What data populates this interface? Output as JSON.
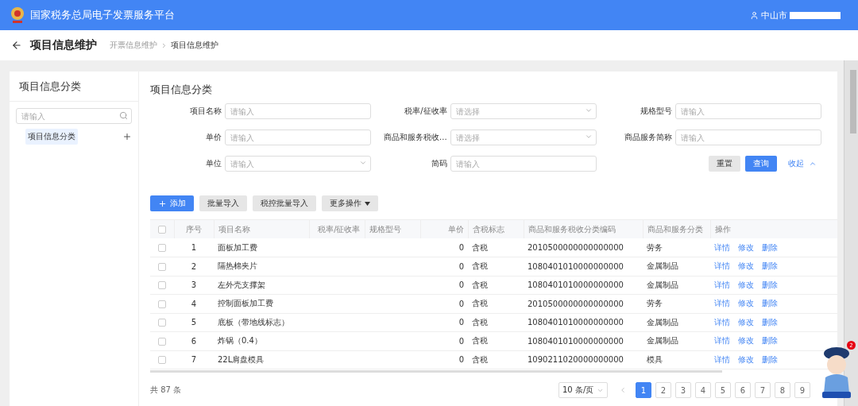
{
  "header": {
    "title": "国家税务总局电子发票服务平台",
    "user": "中山市"
  },
  "page": {
    "title": "项目信息维护",
    "breadcrumb": [
      {
        "label": "开票信息维护",
        "current": false
      },
      {
        "label": "项目信息维护",
        "current": true
      }
    ]
  },
  "sidebar": {
    "title": "项目信息分类",
    "search": {
      "placeholder": "请输入"
    },
    "items": [
      {
        "label": "项目信息分类",
        "selected": true
      }
    ]
  },
  "filter": {
    "title": "项目信息分类",
    "fields": [
      {
        "label": "项目名称",
        "kind": "input",
        "placeholder": "请输入"
      },
      {
        "label": "税率/征收率",
        "kind": "select",
        "placeholder": "请选择"
      },
      {
        "label": "规格型号",
        "kind": "input",
        "placeholder": "请输入"
      },
      {
        "label": "单价",
        "kind": "input",
        "placeholder": "请输入"
      },
      {
        "label": "商品和服务税收...",
        "kind": "select",
        "placeholder": "请选择"
      },
      {
        "label": "商品服务简称",
        "kind": "input",
        "placeholder": "请输入"
      },
      {
        "label": "单位",
        "kind": "select",
        "placeholder": "请输入"
      },
      {
        "label": "简码",
        "kind": "input",
        "placeholder": "请输入"
      }
    ],
    "reset": "重置",
    "query": "查询",
    "collapse": "收起"
  },
  "toolbar": [
    {
      "label": "添加",
      "kind": "primary"
    },
    {
      "label": "批量导入",
      "kind": "plain"
    },
    {
      "label": "税控批量导入",
      "kind": "plain"
    },
    {
      "label": "更多操作",
      "kind": "dropdown"
    }
  ],
  "table": {
    "select_all_checked": false,
    "columns": [
      "序号",
      "项目名称",
      "税率/征收率",
      "规格型号",
      "单价",
      "含税标志",
      "商品和服务税收分类编码",
      "商品和服务分类",
      "操作"
    ],
    "rows": [
      {
        "checked": false,
        "cells": [
          "1",
          "面板加工费",
          "",
          "",
          "0",
          "含税",
          "2010500000000000000",
          "劳务"
        ],
        "actions": [
          "详情",
          "修改",
          "删除"
        ]
      },
      {
        "checked": false,
        "cells": [
          "2",
          "隔热棉夹片",
          "",
          "",
          "0",
          "含税",
          "1080401010000000000",
          "金属制品"
        ],
        "actions": [
          "详情",
          "修改",
          "删除"
        ]
      },
      {
        "checked": false,
        "cells": [
          "3",
          "左外壳支撑架",
          "",
          "",
          "0",
          "含税",
          "1080401010000000000",
          "金属制品"
        ],
        "actions": [
          "详情",
          "修改",
          "删除"
        ]
      },
      {
        "checked": false,
        "cells": [
          "4",
          "控制面板加工费",
          "",
          "",
          "0",
          "含税",
          "2010500000000000000",
          "劳务"
        ],
        "actions": [
          "详情",
          "修改",
          "删除"
        ]
      },
      {
        "checked": false,
        "cells": [
          "5",
          "底板（带地线标志）",
          "",
          "",
          "0",
          "含税",
          "1080401010000000000",
          "金属制品"
        ],
        "actions": [
          "详情",
          "修改",
          "删除"
        ]
      },
      {
        "checked": false,
        "cells": [
          "6",
          "炸锅（0.4）",
          "",
          "",
          "0",
          "含税",
          "1080401010000000000",
          "金属制品"
        ],
        "actions": [
          "详情",
          "修改",
          "删除"
        ]
      },
      {
        "checked": false,
        "cells": [
          "7",
          "22L肩盘模具",
          "",
          "",
          "0",
          "含税",
          "1090211020000000000",
          "模具"
        ],
        "actions": [
          "详情",
          "修改",
          "删除"
        ]
      }
    ]
  },
  "pagination": {
    "total": "共 87 条",
    "page_size": "10 条/页",
    "pages": [
      {
        "label": "1",
        "selected": true
      },
      {
        "label": "2",
        "selected": false
      },
      {
        "label": "3",
        "selected": false
      },
      {
        "label": "4",
        "selected": false
      },
      {
        "label": "5",
        "selected": false
      },
      {
        "label": "6",
        "selected": false
      },
      {
        "label": "7",
        "selected": false
      },
      {
        "label": "8",
        "selected": false
      },
      {
        "label": "9",
        "selected": false
      }
    ]
  },
  "assistant": {
    "badge": "2"
  }
}
